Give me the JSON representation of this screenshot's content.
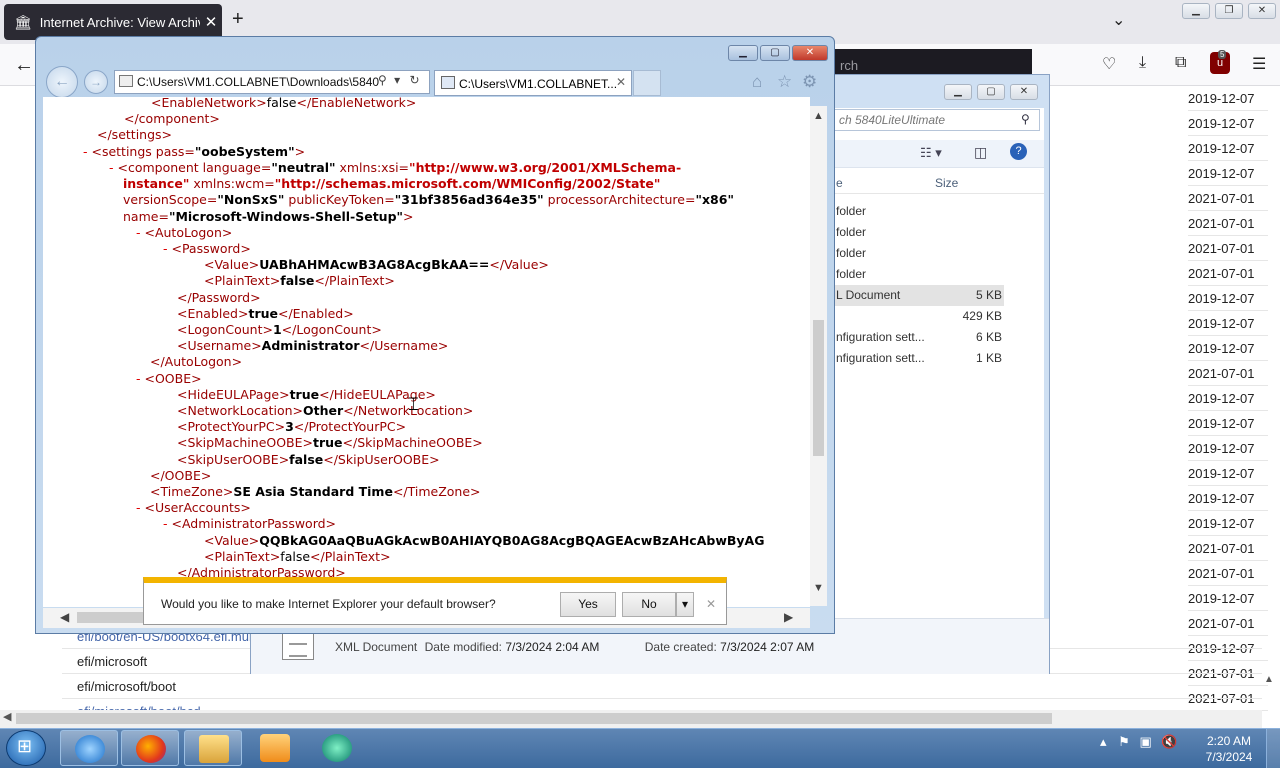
{
  "firefox": {
    "tab_title": "Internet Archive: View Archive",
    "urlbar_text": "rch",
    "ublock_count": "5",
    "dates": [
      "2019-12-07",
      "2019-12-07",
      "2019-12-07",
      "2019-12-07",
      "2021-07-01",
      "2021-07-01",
      "2021-07-01",
      "2021-07-01",
      "2019-12-07",
      "2019-12-07",
      "2019-12-07",
      "2021-07-01",
      "2019-12-07",
      "2019-12-07",
      "2019-12-07",
      "2019-12-07",
      "2019-12-07",
      "2019-12-07",
      "2021-07-01",
      "2021-07-01",
      "2019-12-07",
      "2021-07-01",
      "2019-12-07",
      "2021-07-01",
      "2021-07-01",
      "2021-07-01"
    ],
    "files": [
      "efi/boot/en-US/bootx64.efi.mui",
      "efi/microsoft",
      "efi/microsoft/boot",
      "efi/microsoft/boot/bcd"
    ]
  },
  "explorer": {
    "search_placeholder": "ch 5840LiteUltimate",
    "col_type": "e",
    "col_size": "Size",
    "rows": [
      {
        "name": "folder",
        "size": ""
      },
      {
        "name": "folder",
        "size": ""
      },
      {
        "name": "folder",
        "size": ""
      },
      {
        "name": "folder",
        "size": ""
      },
      {
        "name": "L Document",
        "size": "5 KB"
      },
      {
        "name": "",
        "size": "429 KB"
      },
      {
        "name": "nfiguration sett...",
        "size": "6 KB"
      },
      {
        "name": "nfiguration sett...",
        "size": "1 KB"
      }
    ],
    "status_type": "XML Document",
    "date_modified_label": "Date modified:",
    "date_modified": "7/3/2024 2:04 AM",
    "date_created_label": "Date created:",
    "date_created": "7/3/2024 2:07 AM"
  },
  "ie": {
    "address": "C:\\Users\\VM1.COLLABNET\\Downloads\\5840",
    "tab_title": "C:\\Users\\VM1.COLLABNET...",
    "xml": {
      "EnableNetwork": "false",
      "settings_pass": "oobeSystem",
      "component_language": "neutral",
      "xmlns_xsi_1": "http://www.w3.org/2001/XMLSchema-",
      "xmlns_xsi_2": "instance",
      "xmlns_wcm": "http://schemas.microsoft.com/WMIConfig/2002/State",
      "versionScope": "NonSxS",
      "publicKeyToken": "31bf3856ad364e35",
      "processorArchitecture": "x86",
      "name": "Microsoft-Windows-Shell-Setup",
      "password_value": "UABhAHMAcwB3AG8AcgBkAA==",
      "password_plaintext": "false",
      "enabled": "true",
      "logon_count": "1",
      "username": "Administrator",
      "hide_eula": "true",
      "network_location": "Other",
      "protect_pc": "3",
      "skip_machine_oobe": "true",
      "skip_user_oobe": "false",
      "timezone": "SE Asia Standard Time",
      "admin_password_value": "QQBkAG0AaQBuAGkAcwB0AHIAYQB0AG8AcgBQAGEAcwBzAHcAbwByAG",
      "admin_password_plaintext": "false"
    }
  },
  "notification": {
    "message": "Would you like to make Internet Explorer your default browser?",
    "yes": "Yes",
    "no": "No"
  },
  "taskbar": {
    "time": "2:20 AM",
    "date": "7/3/2024"
  }
}
